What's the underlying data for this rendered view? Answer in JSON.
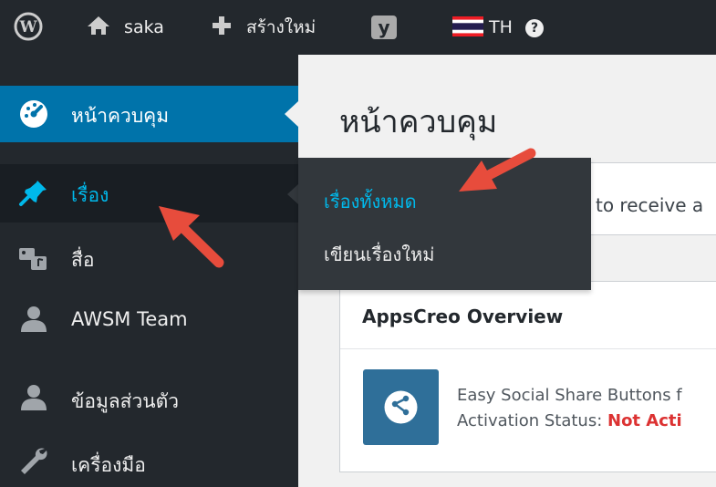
{
  "adminbar": {
    "site_name": "saka",
    "new_label": "สร้างใหม่",
    "lang_label": "TH"
  },
  "sidebar": {
    "items": [
      {
        "label": "หน้าควบคุม"
      },
      {
        "label": "เรื่อง"
      },
      {
        "label": "สื่อ"
      },
      {
        "label": "AWSM Team"
      },
      {
        "label": "ข้อมูลส่วนตัว"
      },
      {
        "label": "เครื่องมือ"
      }
    ]
  },
  "flyout": {
    "items": [
      {
        "label": "เรื่องทั้งหมด"
      },
      {
        "label": "เขียนเรื่องใหม่"
      }
    ]
  },
  "main": {
    "page_title": "หน้าควบคุม",
    "notice_text": "to receive a",
    "overview_title": "AppsCreo Overview",
    "plugin_name": "Easy Social Share Buttons f",
    "activation_label": "Activation Status:",
    "activation_value": "Not Acti"
  },
  "colors": {
    "admin_bar": "#23282d",
    "active_menu": "#0073aa",
    "flyout": "#32373c",
    "link_blue": "#00b9eb",
    "arrow_red": "#e74c3c",
    "not_active_red": "#dc3232"
  }
}
